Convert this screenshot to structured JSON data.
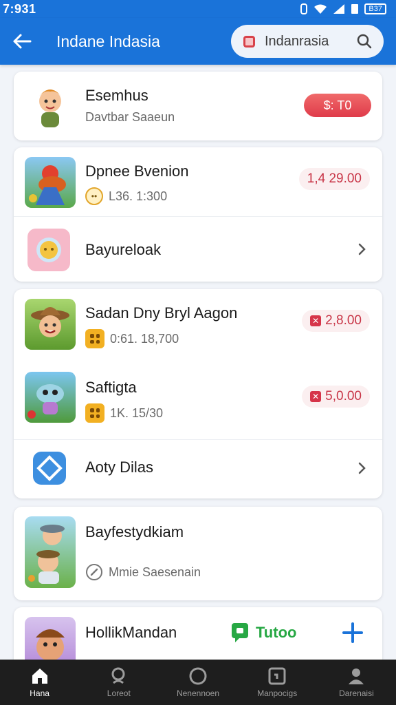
{
  "status_bar": {
    "time": "7:931",
    "battery": "B37"
  },
  "app_bar": {
    "title": "Indane Indasia",
    "search_value": "Indanrasia"
  },
  "items": {
    "esemhus": {
      "name": "Esemhus",
      "subtitle": "Davtbar Saaeun",
      "badge": "$: T0"
    },
    "dpnee": {
      "name": "Dpnee Bvenion",
      "meta": "L36. 1:300",
      "price": "1,4 29.00"
    },
    "bayureloak": {
      "name": "Bayureloak"
    },
    "sadan": {
      "name": "Sadan Dny Bryl Aagon",
      "meta": "0:61. 18,700",
      "price": "2,8.00"
    },
    "saftigta": {
      "name": "Saftigta",
      "meta": "1K. 15/30",
      "price": "5,0.00"
    },
    "aoty": {
      "name": "Aoty Dilas"
    },
    "bayfesty": {
      "name": "Bayfestydkiam",
      "meta": "Mmie Saesenain"
    },
    "hollik": {
      "name": "HollikMandan",
      "chat": "Tutoo"
    }
  },
  "bottom_nav": [
    {
      "label": "Hana",
      "icon": "home-icon",
      "active": true
    },
    {
      "label": "Loreot",
      "icon": "search-icon",
      "active": false
    },
    {
      "label": "Nenennoen",
      "icon": "circle-icon",
      "active": false
    },
    {
      "label": "Manpocigs",
      "icon": "document-icon",
      "active": false
    },
    {
      "label": "Darenaisi",
      "icon": "profile-icon",
      "active": false
    }
  ],
  "colors": {
    "primary": "#1a73d9",
    "price_red": "#c83446",
    "chat_green": "#27a844",
    "nav_bg": "#1e1e1e"
  }
}
